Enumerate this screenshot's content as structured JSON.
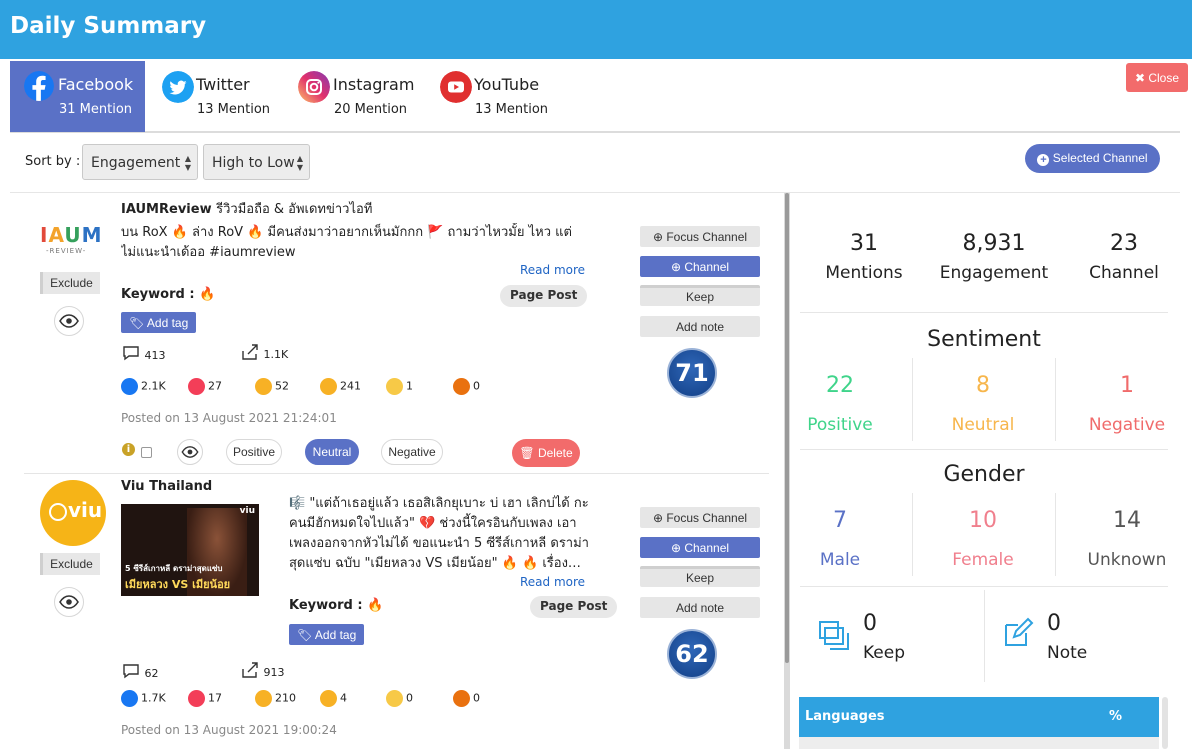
{
  "header": {
    "title": "Daily Summary"
  },
  "tabs": [
    {
      "name": "Facebook",
      "count": "31 Mention"
    },
    {
      "name": "Twitter",
      "count": "13 Mention"
    },
    {
      "name": "Instagram",
      "count": "20 Mention"
    },
    {
      "name": "YouTube",
      "count": "13 Mention"
    }
  ],
  "close_label": "✖ Close",
  "sort": {
    "label": "Sort by :",
    "field": "Engagement",
    "order": "High to Low"
  },
  "selected_channel_label": "Selected Channel",
  "actions": {
    "focus": "Focus Channel",
    "channel": "Channel",
    "keep": "Keep",
    "note": "Add note",
    "exclude": "Exclude",
    "add_tag": "Add tag",
    "read_more": "Read more",
    "page_post": "Page Post",
    "keyword_label": "Keyword :",
    "delete": "Delete",
    "positive": "Positive",
    "neutral": "Neutral",
    "negative": "Negative"
  },
  "posts": [
    {
      "author": "IAUMReview",
      "author_sub": "รีวิวมือถือ & อัพเดทข่าวไอที",
      "line1": "บน RoX 🔥 ล่าง RoV 🔥 มีคนส่งมาว่าอยากเห็นมักกก 🚩 ถามว่าไหวมั้ย ไหว แต่",
      "line2": "ไม่แนะนำเด้ออ #iaumreview",
      "line3": "",
      "line4": "",
      "keyword": "🔥",
      "comments": "413",
      "shares": "1.1K",
      "likes": "2.1K",
      "loves": "27",
      "haha": "52",
      "wow": "241",
      "sad": "1",
      "angry": "0",
      "posted": "Posted on 13 August 2021 21:24:01",
      "score": "71",
      "logo_text": "IAUM",
      "logo_sub": "-REVIEW-"
    },
    {
      "author": "Viu Thailand",
      "author_sub": "",
      "line1": "🎼 \"แต่ถ้าเธอยู่แล้ว เธอสิเลิกยุเบาะ บ่ เฮา เลิกบ่ได้ กะ",
      "line2": "คนมีฮักหมดใจไปแล้ว\" 💔 ช่วงนี้ใครอินกับเพลง เอา",
      "line3": "เพลงออกจากหัวไม่ได้ ขอแนะนำ 5 ซีรีส์เกาหลี ดราม่า",
      "line4": "สุดแซ่บ ฉบับ \"เมียหลวง VS เมียน้อย\" 🔥 🔥 เรื่อง…",
      "keyword": "🔥",
      "comments": "62",
      "shares": "913",
      "likes": "1.7K",
      "loves": "17",
      "haha": "210",
      "wow": "4",
      "sad": "0",
      "angry": "0",
      "posted": "Posted on 13 August 2021 19:00:24",
      "score": "62",
      "logo_text": "viu",
      "thumb_title": "5 ซีรีส์เกาหลี ดราม่าสุดแซ่บ",
      "thumb_sub": "เมียหลวง VS เมียน้อย",
      "thumb_brand": "viu"
    }
  ],
  "summary": {
    "mentions": "31",
    "mentions_label": "Mentions",
    "engagement": "8,931",
    "engagement_label": "Engagement",
    "channel": "23",
    "channel_label": "Channel"
  },
  "sentiment": {
    "title": "Sentiment",
    "positive": "22",
    "positive_label": "Positive",
    "neutral": "8",
    "neutral_label": "Neutral",
    "negative": "1",
    "negative_label": "Negative"
  },
  "gender": {
    "title": "Gender",
    "male": "7",
    "male_label": "Male",
    "female": "10",
    "female_label": "Female",
    "unknown": "14",
    "unknown_label": "Unknown"
  },
  "keep": {
    "count": "0",
    "label": "Keep"
  },
  "note": {
    "count": "0",
    "label": "Note"
  },
  "languages": {
    "label": "Languages",
    "pct": "%"
  },
  "colors": {
    "header": "#2fa2e0",
    "accent": "#5a71c6",
    "danger": "#f26b6b",
    "positive": "#3fd48a",
    "neutral": "#f7b64c",
    "negative": "#f06b6b",
    "male": "#5a71c6",
    "female": "#f07f8d"
  }
}
